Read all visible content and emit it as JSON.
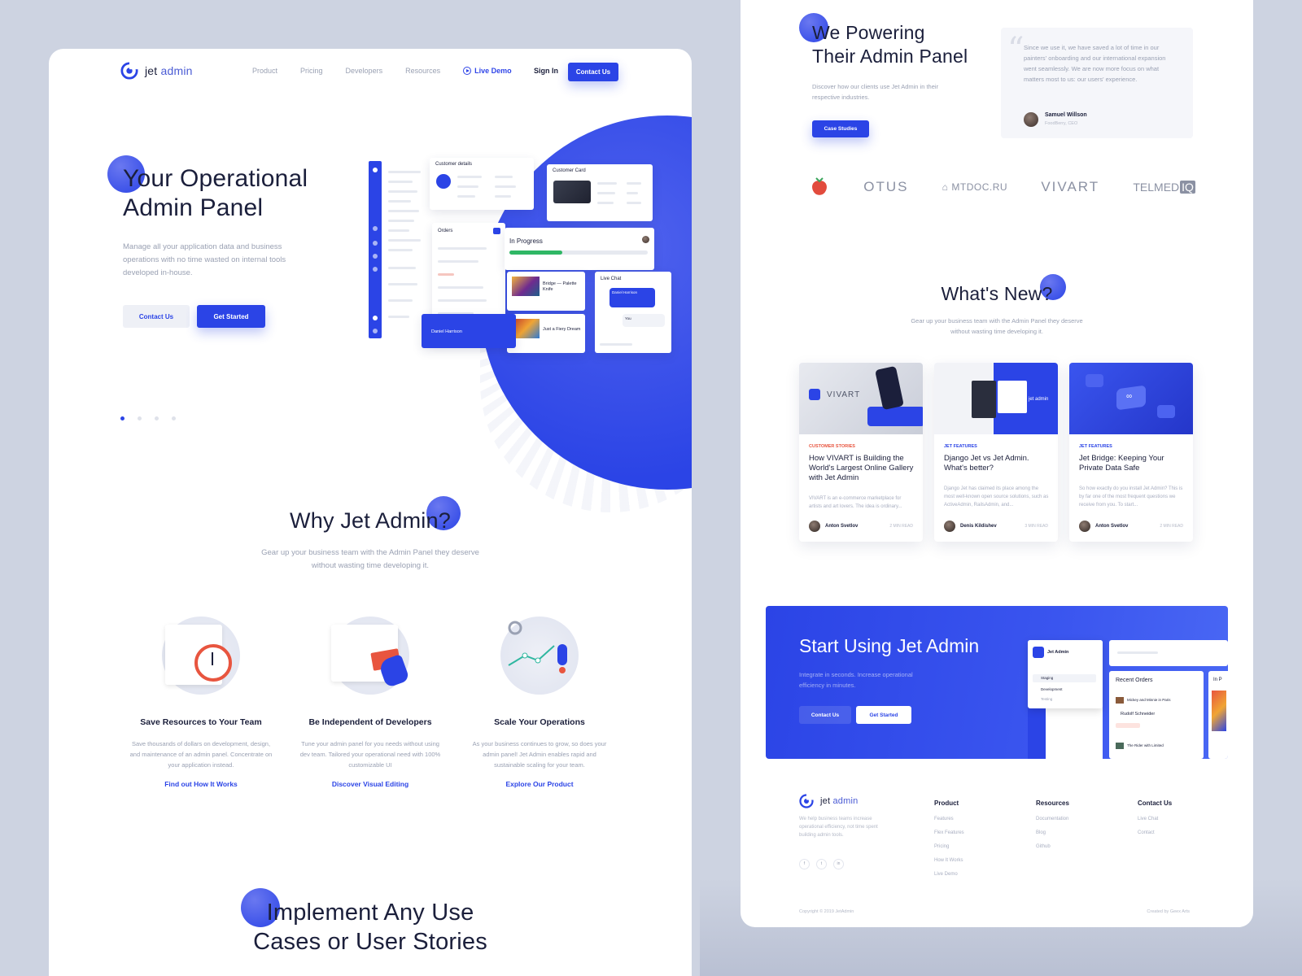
{
  "logo": {
    "word1": "jet",
    "word2": "admin"
  },
  "nav": {
    "product": "Product",
    "pricing": "Pricing",
    "developers": "Developers",
    "resources": "Resources",
    "live_demo": "Live Demo",
    "sign_in": "Sign In",
    "contact_us": "Contact Us"
  },
  "hero": {
    "title_line1": "Your Operational",
    "title_line2": "Admin Panel",
    "description": "Manage all your application data and business operations with no time wasted on internal tools developed in-house.",
    "btn_contact": "Contact Us",
    "btn_start": "Get Started",
    "slides_total": 4,
    "slide_active": 1
  },
  "mock": {
    "customer_details": "Customer details",
    "customer_card": "Customer Card",
    "orders": "Orders",
    "in_progress": "In Progress",
    "item1_title": "Bridge — Palette Knife",
    "item2_title": "Just a Fiery Dream",
    "live_chat": "Live Chat",
    "chat_name": "Daniel Harrison",
    "chat_you": "You",
    "order_user": "Daniel Harrison",
    "progress": 0.38
  },
  "why": {
    "title": "Why Jet Admin?",
    "subtitle": "Gear up your business team with the Admin Panel they deserve without wasting time developing it.",
    "features": [
      {
        "title": "Save Resources to Your Team",
        "text": "Save thousands of dollars on development, design, and maintenance of an admin panel. Concentrate on your application instead.",
        "link": "Find out How It Works"
      },
      {
        "title": "Be Independent of Developers",
        "text": "Tune your admin panel for you needs without using dev team. Tailored your operational need with 100% customizable UI",
        "link": "Discover Visual Editing"
      },
      {
        "title": "Scale Your Operations",
        "text": "As your business continues to grow, so does your admin panel! Jet Admin enables rapid and sustainable scaling for your team.",
        "link": "Explore Our Product"
      }
    ]
  },
  "implement": {
    "line1": "Implement Any Use",
    "line2": "Cases or User Stories"
  },
  "powering": {
    "title_line1": "We Powering",
    "title_line2": "Their Admin Panel",
    "description": "Discover how our clients use Jet Admin in their respective industries.",
    "button": "Case Studies",
    "quote": "Since we use it, we have saved a lot of time in our painters' onboarding and our international expansion went seamlessly. We are now more focus on what matters most to us: our users' experience.",
    "author_name": "Samuel Willson",
    "author_role": "FoodBerry, CEO"
  },
  "brands": [
    "OTUS",
    "MTDOC.RU",
    "VIVART",
    "TELMED",
    "IQ"
  ],
  "whats_new": {
    "title": "What's New?",
    "subtitle": "Gear up your business team with the Admin Panel they deserve without wasting time developing it.",
    "articles": [
      {
        "tag": "CUSTOMER STORIES",
        "title": "How VIVART is Building the World's Largest Online Gallery with Jet Admin",
        "desc": "VIVART is an e-commerce marketplace for artists and art lovers. The idea is ordinary...",
        "author": "Anton Svetlov",
        "read": "2 MIN READ",
        "img_label": "VIVART"
      },
      {
        "tag": "JET FEATURES",
        "title": "Django Jet vs Jet Admin. What's better?",
        "desc": "Django Jet has claimed its place among the most well-known open source solutions, such as ActiveAdmin, RailsAdmin, and...",
        "author": "Denis Kildishev",
        "read": "3 MIN READ",
        "img_label": "jet admin"
      },
      {
        "tag": "JET FEATURES",
        "title": "Jet Bridge: Keeping Your Private Data Safe",
        "desc": "So how exactly do you install Jet Admin? This is by far one of the most frequent questions we receive from you. To start...",
        "author": "Anton Svetlov",
        "read": "2 MIN READ",
        "img_label": ""
      }
    ]
  },
  "cta": {
    "title": "Start Using Jet Admin",
    "description": "Integrate in seconds. Increase operational efficiency in minutes.",
    "btn_contact": "Contact Us",
    "btn_start": "Get Started",
    "mock_app": "Jet Admin",
    "env_staging": "Staging",
    "env_dev": "Development",
    "env_testing": "Testing",
    "recent_orders": "Recent Orders",
    "order1": "Mickey and Minnie in Paris",
    "order_user": "Rudolf Schneider",
    "order2": "The Rider with Limited",
    "in_p": "In P"
  },
  "footer": {
    "tagline": "We help business teams increase operational efficiency, not time spent building admin tools.",
    "social": [
      "f",
      "t",
      "in"
    ],
    "product_title": "Product",
    "product_links": [
      "Features",
      "Flex Features",
      "Pricing",
      "How It Works",
      "Live Demo"
    ],
    "resources_title": "Resources",
    "resources_links": [
      "Documentation",
      "Blog",
      "Github"
    ],
    "contact_title": "Contact Us",
    "contact_links": [
      "Live Chat",
      "Contact"
    ],
    "copyright": "Copyright © 2019 JetAdmin",
    "created_by": "Created by Geex Arts"
  },
  "colors": {
    "primary": "#2b44e6",
    "text": "#1b1f3b",
    "muted": "#9aa1b3",
    "tag_red": "#e8553f",
    "tag_blue": "#2b44e6"
  }
}
